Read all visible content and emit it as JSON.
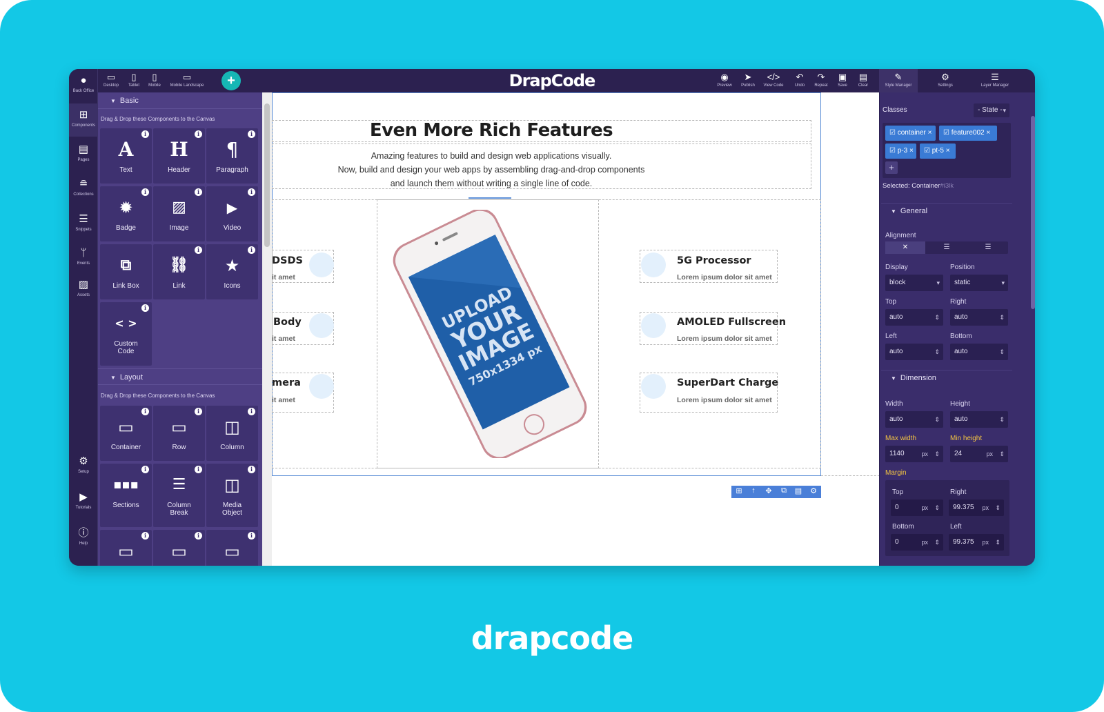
{
  "app": {
    "brand": "drapcode",
    "logo": "DrapCode"
  },
  "devices": [
    {
      "label": "Desktop",
      "icon": "desktop-icon"
    },
    {
      "label": "Tablet",
      "icon": "tablet-icon"
    },
    {
      "label": "Mobile",
      "icon": "mobile-icon"
    },
    {
      "label": "Mobile Landscape",
      "icon": "mobile-landscape-icon"
    }
  ],
  "toolbar": [
    {
      "label": "Preview",
      "icon": "eye-icon"
    },
    {
      "label": "Publish",
      "icon": "send-icon"
    },
    {
      "label": "View Code",
      "icon": "code-icon"
    },
    {
      "label": "Undo",
      "icon": "undo-icon"
    },
    {
      "label": "Repeat",
      "icon": "redo-icon"
    },
    {
      "label": "Save",
      "icon": "save-icon"
    },
    {
      "label": "Clear",
      "icon": "trash-icon"
    },
    {
      "label": "Style Manager",
      "icon": "brush-icon"
    },
    {
      "label": "Settings",
      "icon": "gear-icon"
    },
    {
      "label": "Layer Manager",
      "icon": "layers-icon"
    }
  ],
  "sidebar": [
    {
      "label": "Back Office",
      "icon": "user-icon"
    },
    {
      "label": "Components",
      "icon": "plus-square-icon"
    },
    {
      "label": "Pages",
      "icon": "page-icon"
    },
    {
      "label": "Collections",
      "icon": "database-icon"
    },
    {
      "label": "Snippets",
      "icon": "list-icon"
    },
    {
      "label": "Events",
      "icon": "branch-icon"
    },
    {
      "label": "Assets",
      "icon": "image-icon"
    },
    {
      "label": "Setup",
      "icon": "gears-icon"
    },
    {
      "label": "Tutorials",
      "icon": "youtube-icon"
    },
    {
      "label": "Help",
      "icon": "info-icon"
    }
  ],
  "components": {
    "basic": {
      "title": "Basic",
      "hint": "Drag & Drop these Components to the Canvas",
      "items": [
        {
          "label": "Text",
          "icon": "text-icon"
        },
        {
          "label": "Header",
          "icon": "header-icon"
        },
        {
          "label": "Paragraph",
          "icon": "paragraph-icon"
        },
        {
          "label": "Badge",
          "icon": "badge-icon"
        },
        {
          "label": "Image",
          "icon": "image-icon"
        },
        {
          "label": "Video",
          "icon": "video-icon"
        },
        {
          "label": "Link Box",
          "icon": "link-box-icon"
        },
        {
          "label": "Link",
          "icon": "link-icon"
        },
        {
          "label": "Icons",
          "icon": "star-icon"
        },
        {
          "label": "Custom\nCode",
          "icon": "code-icon"
        }
      ]
    },
    "layout": {
      "title": "Layout",
      "hint": "Drag & Drop these Components to the Canvas",
      "items": [
        {
          "label": "Container",
          "icon": "container-icon"
        },
        {
          "label": "Row",
          "icon": "row-icon"
        },
        {
          "label": "Column",
          "icon": "column-icon"
        },
        {
          "label": "Sections",
          "icon": "sections-icon"
        },
        {
          "label": "Column\nBreak",
          "icon": "column-break-icon"
        },
        {
          "label": "Media\nObject",
          "icon": "media-object-icon"
        }
      ]
    }
  },
  "canvas": {
    "heading": "Even More Rich Features",
    "paragraph": [
      "Amazing features to build and design web applications visually.",
      "Now, build and design your web apps by assembling drag-and-drop components",
      "and launch them without writing a single line of code."
    ],
    "left_features": [
      {
        "title": "DSDS",
        "sub": "it amet"
      },
      {
        "title": "Body",
        "sub": "it amet"
      },
      {
        "title": "mera",
        "sub": "it amet"
      }
    ],
    "right_features": [
      {
        "title": "5G Processor",
        "sub": "Lorem ipsum dolor sit amet"
      },
      {
        "title": "AMOLED Fullscreen",
        "sub": "Lorem ipsum dolor sit amet"
      },
      {
        "title": "SuperDart Charge",
        "sub": "Lorem ipsum dolor sit amet"
      }
    ],
    "phone_placeholder": [
      "UPLOAD",
      "YOUR",
      "IMAGE",
      "750x1334 px"
    ],
    "element_tools": [
      "add-icon",
      "arrow-up-icon",
      "move-icon",
      "copy-icon",
      "delete-icon",
      "settings-icon"
    ]
  },
  "style_manager": {
    "classes_label": "Classes",
    "state_select": "- State -",
    "classes": [
      "container",
      "feature002",
      "p-3",
      "pt-5"
    ],
    "selected_label": "Selected:",
    "selected_value": "Container",
    "selected_id": "#i3lk",
    "general": {
      "title": "General",
      "alignment_label": "Alignment",
      "display_label": "Display",
      "display_value": "block",
      "position_label": "Position",
      "position_value": "static",
      "top_label": "Top",
      "top_value": "auto",
      "right_label": "Right",
      "right_value": "auto",
      "left_label": "Left",
      "left_value": "auto",
      "bottom_label": "Bottom",
      "bottom_value": "auto"
    },
    "dimension": {
      "title": "Dimension",
      "width_label": "Width",
      "width_value": "auto",
      "height_label": "Height",
      "height_value": "auto",
      "max_width_label": "Max width",
      "max_width_value": "1140",
      "max_width_unit": "px",
      "min_height_label": "Min height",
      "min_height_value": "24",
      "min_height_unit": "px",
      "margin_label": "Margin",
      "margin_top_label": "Top",
      "margin_top_value": "0",
      "margin_right_label": "Right",
      "margin_right_value": "99.375",
      "margin_bottom_label": "Bottom",
      "margin_bottom_value": "0",
      "margin_left_label": "Left",
      "margin_left_value": "99.375",
      "unit": "px"
    }
  }
}
